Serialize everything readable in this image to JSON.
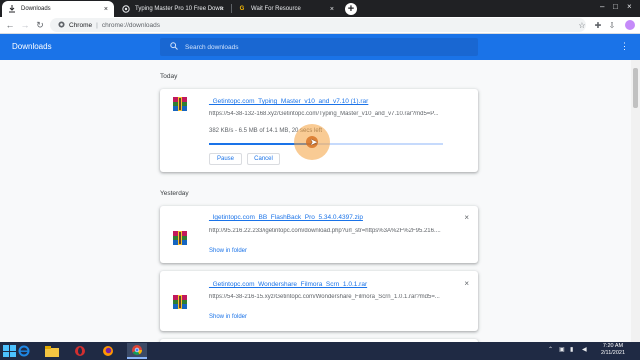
{
  "tabs": [
    {
      "title": "Downloads",
      "icon": "download-icon",
      "active": true
    },
    {
      "title": "Typing Master Pro 10 Free Down",
      "icon": "site-icon",
      "active": false
    },
    {
      "title": "Wait For Resource",
      "icon": "google-icon",
      "active": false
    }
  ],
  "omnibox": {
    "site": "Chrome",
    "separator": "|",
    "url": "chrome://downloads"
  },
  "header": {
    "title": "Downloads",
    "search_placeholder": "Search downloads"
  },
  "sections": [
    {
      "label": "Today",
      "items": [
        {
          "name": "_Getintopc.com_Typing_Master_v10_and_v7.10 (1).rar",
          "url": "https://54-38-132-168.xyz/Getintopc.com/Typing_Master_v10_and_v7.10.rar?md5=P...",
          "status": "382 KB/s - 6.5 MB of 14.1 MB, 20 secs left",
          "progress_fraction": 0.46,
          "actions": [
            "Pause",
            "Cancel"
          ]
        }
      ]
    },
    {
      "label": "Yesterday",
      "items": [
        {
          "name": "_Igetintopc.com_BB_FlashBack_Pro_5.34.0.4397.zip",
          "url": "http://95.216.22.233/igetintopc.com/download.php?url_str=https%3A%2F%2F95.216....",
          "link": "Show in folder"
        },
        {
          "name": "_Getintopc.com_Wondershare_Filmora_Scrn_1.0.1.rar",
          "url": "https://54-38-216-15.xyz/Getintopc.com/Wondershare_Filmora_Scrn_1.0.1.rar?md5=...",
          "link": "Show in folder"
        }
      ]
    }
  ],
  "taskbar": {
    "time": "7:20 AM",
    "date": "2/11/2021"
  },
  "colors": {
    "accent": "#1a73e8",
    "header": "#1a73e8",
    "taskbar": "#1f2a44"
  }
}
